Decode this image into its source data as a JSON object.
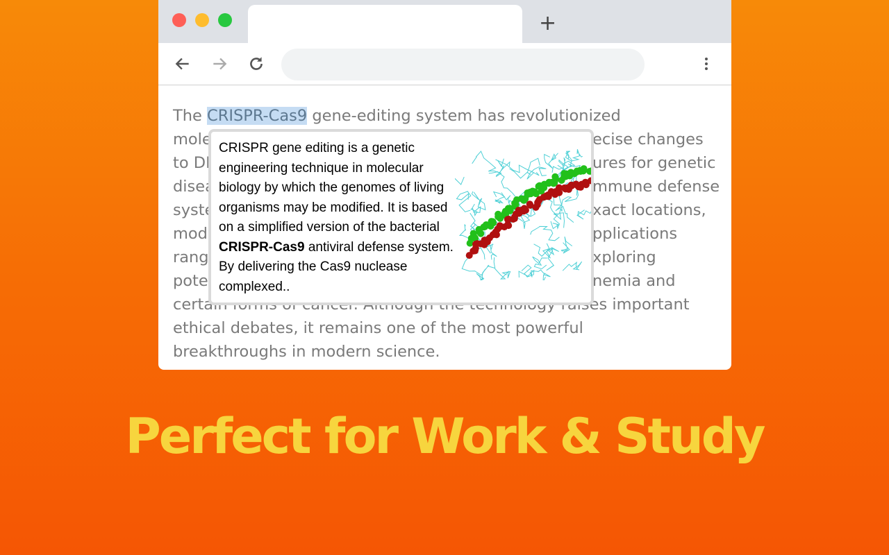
{
  "browser": {
    "traffic_lights": {
      "close": "#fe5f57",
      "minimize": "#febc2e",
      "maximize": "#28c840"
    },
    "new_tab_label": "+",
    "icons": [
      "back-arrow-icon",
      "forward-arrow-icon",
      "reload-icon",
      "more-vert-icon"
    ]
  },
  "article": {
    "line0": {
      "before": "The ",
      "highlight": "CRISPR-Cas9",
      "after": " gene-editing system has revolutionized"
    },
    "left": [
      "mole",
      "to DN",
      "disea",
      "syste",
      "modi",
      "rang",
      "pote"
    ],
    "right": [
      "ecise changes",
      "ures for genetic",
      "mmune defense",
      "xact locations,",
      "pplications",
      "xploring",
      "nemia and"
    ],
    "line8": "certain forms of cancer. Although the technology raises important",
    "line9": "ethical debates, it remains one of the most powerful",
    "line10": "breakthroughs in modern science.",
    "highlight_color": "#c5dcf3"
  },
  "popup": {
    "text_before": "CRISPR gene editing is a genetic engineering technique in molecular biology by which the genomes of living organisms may be modified. It is based on a simplified version of the bacterial ",
    "text_bold": "CRISPR-Cas9",
    "text_after": " antiviral defense system. By delivering the Cas9 nuclease complexed..",
    "image": "crispr-cas9-protein-structure"
  },
  "headline": "Perfect for Work & Study",
  "colors": {
    "headline": "#f7d53e",
    "bg_top": "#f78a08",
    "bg_bottom": "#f55604"
  }
}
